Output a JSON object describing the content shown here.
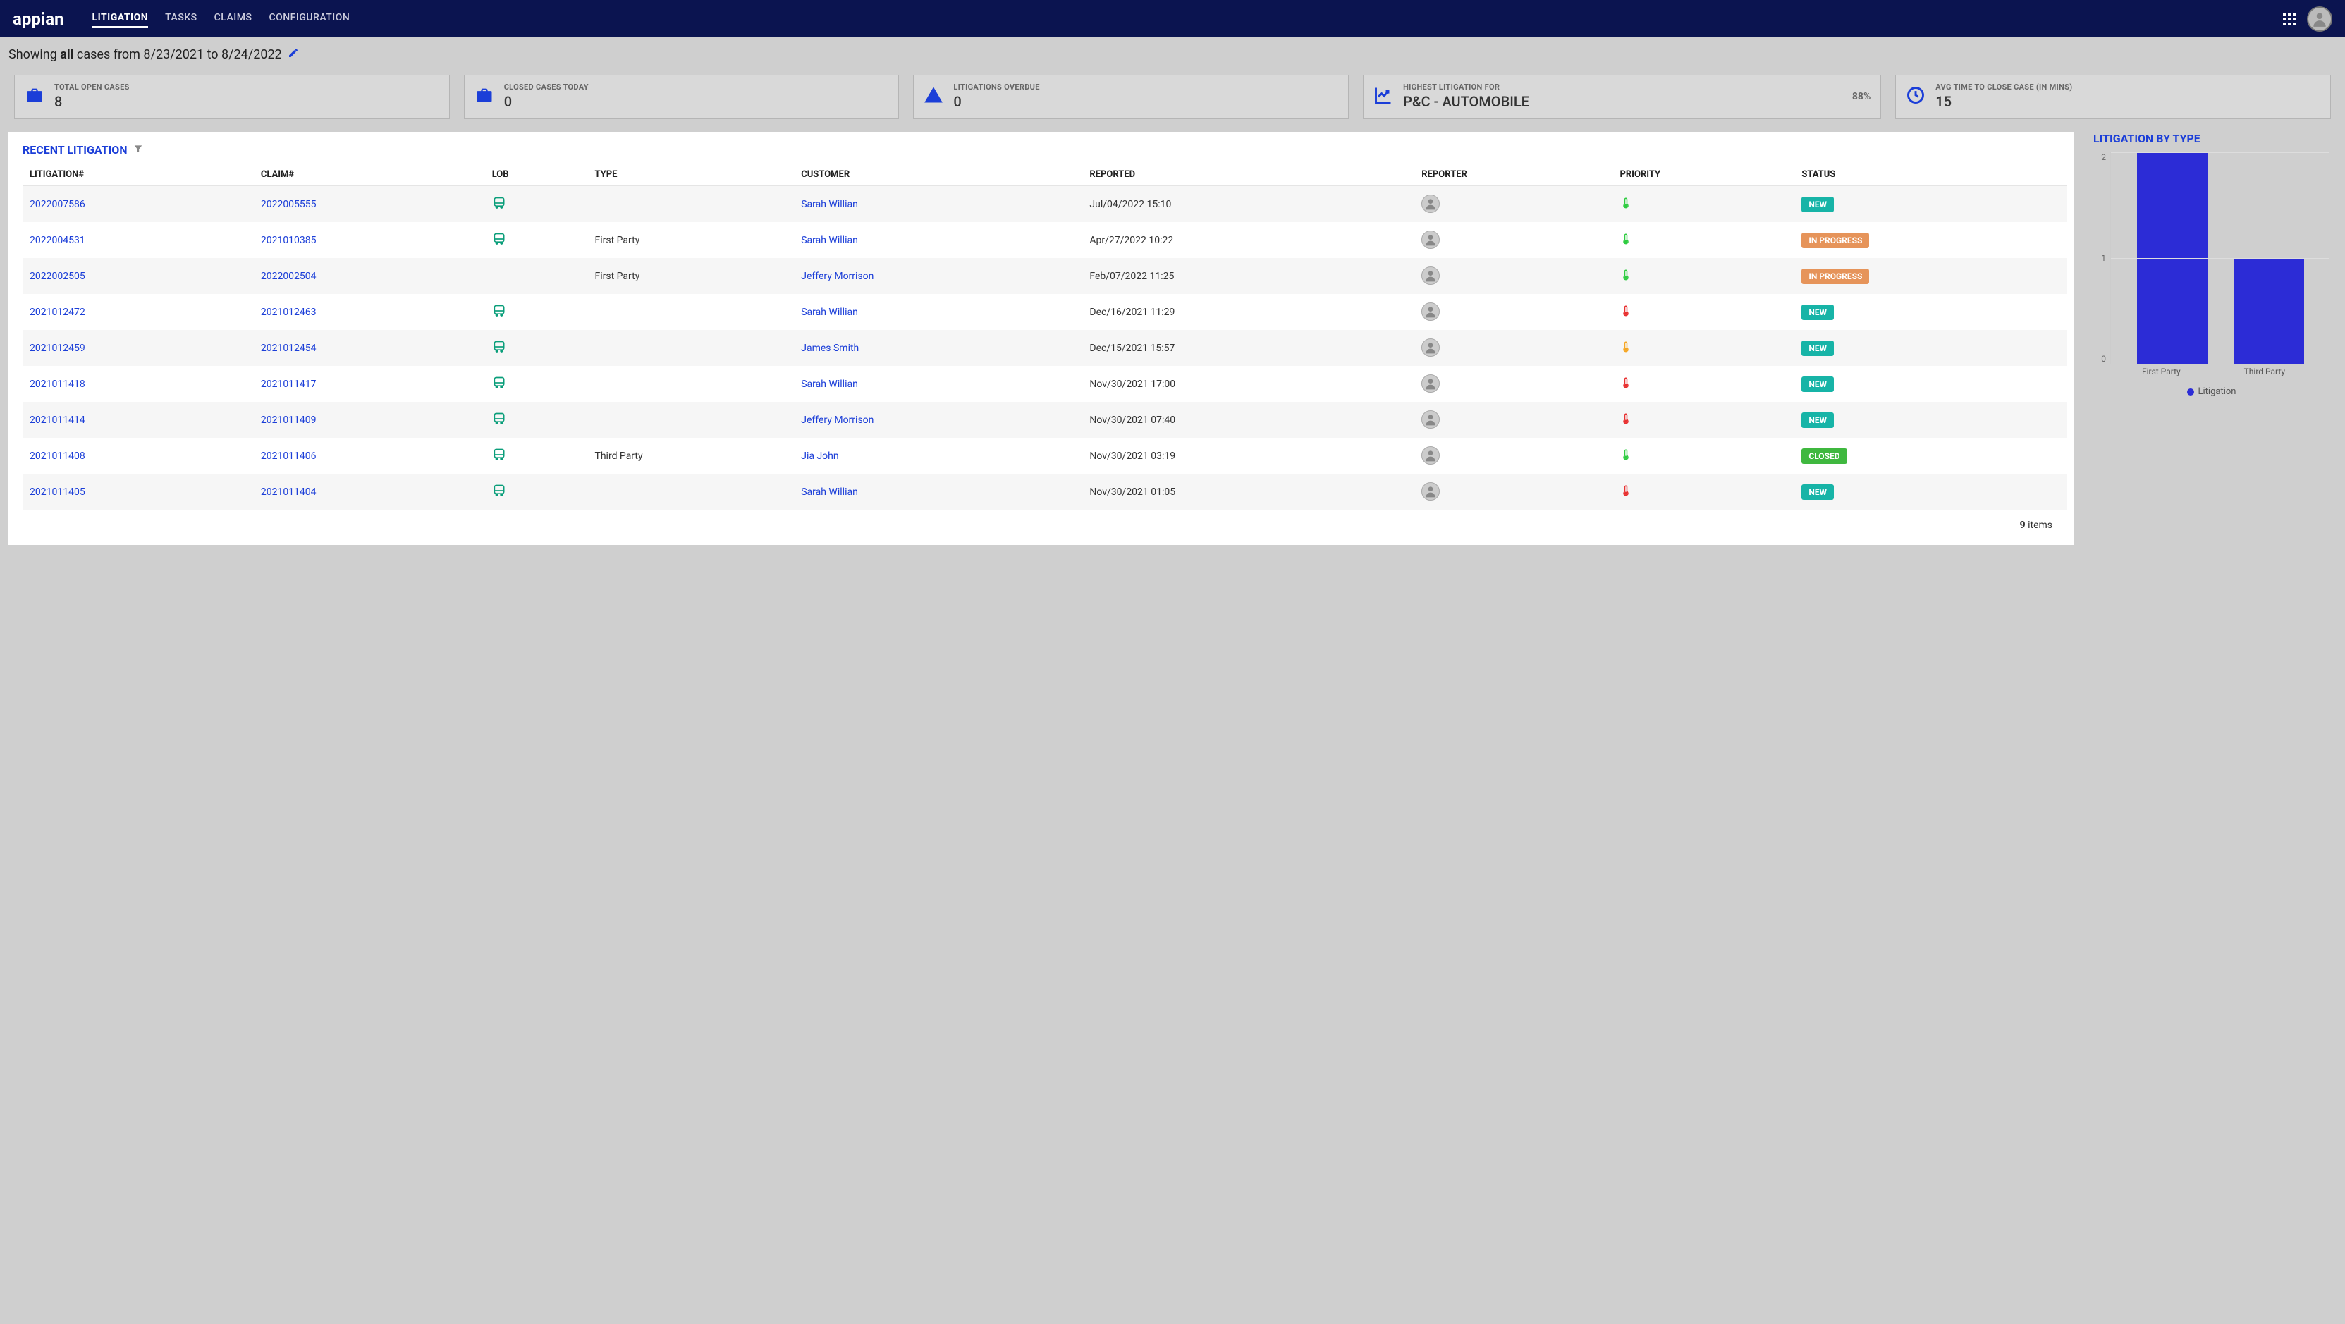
{
  "header": {
    "logo": "appian",
    "nav": [
      "LITIGATION",
      "TASKS",
      "CLAIMS",
      "CONFIGURATION"
    ],
    "active_nav_index": 0
  },
  "subheader": {
    "prefix": "Showing ",
    "bold": "all",
    "rest": " cases from 8/23/2021 to 8/24/2022"
  },
  "kpis": [
    {
      "icon": "briefcase",
      "label": "TOTAL OPEN CASES",
      "value": "8"
    },
    {
      "icon": "briefcase",
      "label": "CLOSED CASES TODAY",
      "value": "0"
    },
    {
      "icon": "warning",
      "label": "LITIGATIONS OVERDUE",
      "value": "0"
    },
    {
      "icon": "chart",
      "label": "HIGHEST LITIGATION FOR",
      "value": "P&C - AUTOMOBILE",
      "pct": "88%"
    },
    {
      "icon": "clock",
      "label": "AVG TIME TO CLOSE CASE (IN MINS)",
      "value": "15"
    }
  ],
  "table": {
    "title": "RECENT LITIGATION",
    "columns": [
      "LITIGATION#",
      "CLAIM#",
      "LOB",
      "TYPE",
      "CUSTOMER",
      "REPORTED",
      "REPORTER",
      "PRIORITY",
      "STATUS"
    ],
    "rows": [
      {
        "litigation": "2022007586",
        "claim": "2022005555",
        "lob": "bus",
        "type": "",
        "customer": "Sarah Willian",
        "reported": "Jul/04/2022 15:10",
        "reporter": "avatar",
        "priority": "green",
        "status": "NEW",
        "status_class": "new"
      },
      {
        "litigation": "2022004531",
        "claim": "2021010385",
        "lob": "bus",
        "type": "First Party",
        "customer": "Sarah Willian",
        "reported": "Apr/27/2022 10:22",
        "reporter": "avatar",
        "priority": "green",
        "status": "IN PROGRESS",
        "status_class": "progress"
      },
      {
        "litigation": "2022002505",
        "claim": "2022002504",
        "lob": "",
        "type": "First Party",
        "customer": "Jeffery Morrison",
        "reported": "Feb/07/2022 11:25",
        "reporter": "avatar",
        "priority": "green",
        "status": "IN PROGRESS",
        "status_class": "progress"
      },
      {
        "litigation": "2021012472",
        "claim": "2021012463",
        "lob": "bus",
        "type": "",
        "customer": "Sarah Willian",
        "reported": "Dec/16/2021 11:29",
        "reporter": "avatar",
        "priority": "red",
        "status": "NEW",
        "status_class": "new"
      },
      {
        "litigation": "2021012459",
        "claim": "2021012454",
        "lob": "bus",
        "type": "",
        "customer": "James Smith",
        "reported": "Dec/15/2021 15:57",
        "reporter": "avatar",
        "priority": "orange",
        "status": "NEW",
        "status_class": "new"
      },
      {
        "litigation": "2021011418",
        "claim": "2021011417",
        "lob": "bus",
        "type": "",
        "customer": "Sarah Willian",
        "reported": "Nov/30/2021 17:00",
        "reporter": "avatar",
        "priority": "red",
        "status": "NEW",
        "status_class": "new"
      },
      {
        "litigation": "2021011414",
        "claim": "2021011409",
        "lob": "bus",
        "type": "",
        "customer": "Jeffery Morrison",
        "reported": "Nov/30/2021 07:40",
        "reporter": "avatar",
        "priority": "red",
        "status": "NEW",
        "status_class": "new"
      },
      {
        "litigation": "2021011408",
        "claim": "2021011406",
        "lob": "bus",
        "type": "Third Party",
        "customer": "Jia John",
        "reported": "Nov/30/2021 03:19",
        "reporter": "avatar",
        "priority": "green",
        "status": "CLOSED",
        "status_class": "closed"
      },
      {
        "litigation": "2021011405",
        "claim": "2021011404",
        "lob": "bus",
        "type": "",
        "customer": "Sarah Willian",
        "reported": "Nov/30/2021 01:05",
        "reporter": "avatar",
        "priority": "red",
        "status": "NEW",
        "status_class": "new"
      }
    ],
    "footer_count": "9",
    "footer_suffix": " items"
  },
  "chart_title": "LITIGATION BY TYPE",
  "chart_legend": "Litigation",
  "chart_data": {
    "type": "bar",
    "categories": [
      "First Party",
      "Third Party"
    ],
    "values": [
      2,
      1
    ],
    "title": "LITIGATION BY TYPE",
    "xlabel": "",
    "ylabel": "",
    "ylim": [
      0,
      2
    ],
    "y_ticks": [
      0,
      1,
      2
    ],
    "series": [
      {
        "name": "Litigation",
        "values": [
          2,
          1
        ]
      }
    ]
  }
}
